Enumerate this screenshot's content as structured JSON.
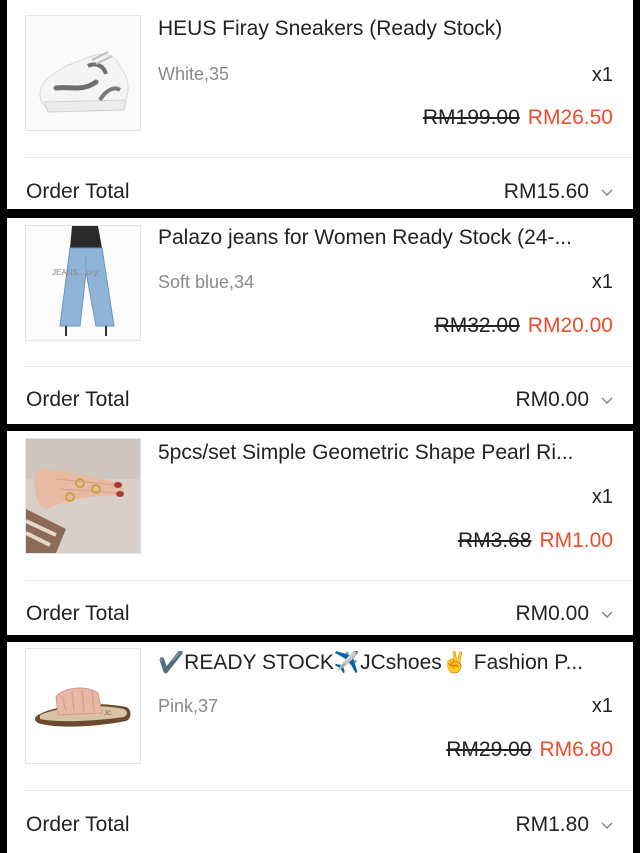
{
  "orders": [
    {
      "title": "HEUS Firay Sneakers (Ready Stock)",
      "variant": "White,35",
      "qty": "x1",
      "old_price": "RM199.00",
      "new_price": "RM26.50",
      "total_label": "Order Total",
      "total_value": "RM15.60",
      "thumb_icon": "sneaker-icon"
    },
    {
      "title": "Palazo jeans for Women Ready Stock (24-...",
      "variant": "Soft blue,34",
      "qty": "x1",
      "old_price": "RM32.00",
      "new_price": "RM20.00",
      "total_label": "Order Total",
      "total_value": "RM0.00",
      "thumb_icon": "jeans-icon",
      "thumb_text": "JEANS... ory:"
    },
    {
      "title": "5pcs/set Simple Geometric Shape Pearl Ri...",
      "variant": "",
      "qty": "x1",
      "old_price": "RM3.68",
      "new_price": "RM1.00",
      "total_label": "Order Total",
      "total_value": "RM0.00",
      "thumb_icon": "rings-hand-icon"
    },
    {
      "title": "✔️READY STOCK✈️JCshoes✌️ Fashion P...",
      "variant": "Pink,37",
      "qty": "x1",
      "old_price": "RM29.00",
      "new_price": "RM6.80",
      "total_label": "Order Total",
      "total_value": "RM1.80",
      "thumb_icon": "sandal-icon"
    }
  ],
  "colors": {
    "accent": "#ee4d2d",
    "text": "#222222",
    "muted": "#8a8a8a",
    "divider": "#e8e8e8"
  }
}
